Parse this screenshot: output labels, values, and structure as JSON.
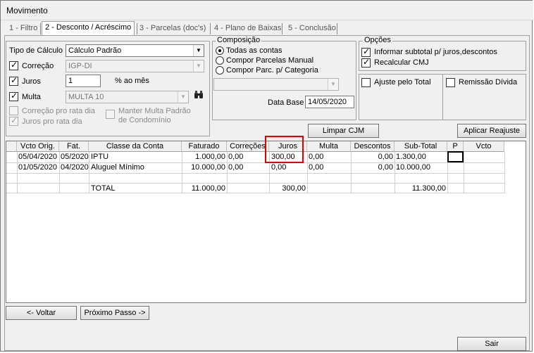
{
  "window": {
    "title": "Movimento"
  },
  "tabs": [
    {
      "label": "1 - Filtro"
    },
    {
      "label": "2 - Desconto / Acréscimo"
    },
    {
      "label": "3 - Parcelas (doc's)"
    },
    {
      "label": "4 - Plano de Baixas"
    },
    {
      "label": "5 - Conclusão"
    }
  ],
  "calc": {
    "tipo_label": "Tipo de Cálculo",
    "tipo_value": "Cálculo Padrão",
    "correcao_label": "Correção",
    "correcao_value": "IGP-DI",
    "juros_label": "Juros",
    "juros_value": "1",
    "juros_unit": "% ao mês",
    "multa_label": "Multa",
    "multa_value": "MULTA 10",
    "corr_pro_rata": "Correção pro rata dia",
    "juros_pro_rata": "Juros pro rata dia",
    "manter_multa_1": "Manter Multa Padrão",
    "manter_multa_2": "de Condomínio"
  },
  "composicao": {
    "title": "Composição",
    "options": [
      "Todas as contas",
      "Compor Parcelas Manual",
      "Compor Parc. p/ Categoria"
    ],
    "data_base_label": "Data Base",
    "data_base_value": "14/05/2020"
  },
  "opcoes": {
    "title": "Opções",
    "informar_subtotal": "Informar subtotal p/ juros,descontos",
    "recalcular_cmj": "Recalcular CMJ",
    "ajuste_total": "Ajuste pelo Total",
    "remissao_divida": "Remissão Dívida"
  },
  "buttons": {
    "limpar_cjm": "Limpar CJM",
    "aplicar_reajuste": "Aplicar Reajuste",
    "voltar": "<- Voltar",
    "proximo": "Próximo Passo ->",
    "sair": "Sair"
  },
  "grid": {
    "headers": [
      "Vcto Orig.",
      "Fat.",
      "Classe da Conta",
      "Faturado",
      "Correções",
      "Juros",
      "Multa",
      "Descontos",
      "Sub-Total",
      "P",
      "Vcto"
    ],
    "rows": [
      {
        "vcto": "05/04/2020",
        "fat": "05/2020",
        "classe": "IPTU",
        "faturado": "1.000,00",
        "correcoes": "0,00",
        "juros": "300,00",
        "multa": "0,00",
        "descontos": "0,00",
        "subtotal": "1.300,00"
      },
      {
        "vcto": "01/05/2020",
        "fat": "04/2020",
        "classe": "Aluguel Mínimo",
        "faturado": "10.000,00",
        "correcoes": "0,00",
        "juros": "0,00",
        "multa": "0,00",
        "descontos": "0,00",
        "subtotal": "10.000,00"
      }
    ],
    "total": {
      "label": "TOTAL",
      "faturado": "11.000,00",
      "juros": "300,00",
      "subtotal": "11.300,00"
    }
  },
  "colors": {
    "highlight": "#e00000"
  }
}
